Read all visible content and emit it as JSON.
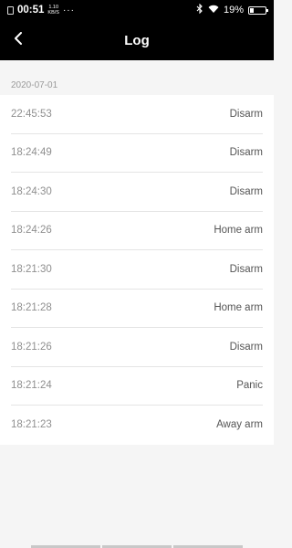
{
  "status_bar": {
    "time": "00:51",
    "speed_value": "1.10",
    "speed_unit": "KB/S",
    "dots": "···",
    "battery": "19%"
  },
  "header": {
    "title": "Log"
  },
  "log": {
    "date": "2020-07-01",
    "entries": [
      {
        "time": "22:45:53",
        "event": "Disarm"
      },
      {
        "time": "18:24:49",
        "event": "Disarm"
      },
      {
        "time": "18:24:30",
        "event": "Disarm"
      },
      {
        "time": "18:24:26",
        "event": "Home arm"
      },
      {
        "time": "18:21:30",
        "event": "Disarm"
      },
      {
        "time": "18:21:28",
        "event": "Home arm"
      },
      {
        "time": "18:21:26",
        "event": "Disarm"
      },
      {
        "time": "18:21:24",
        "event": "Panic"
      },
      {
        "time": "18:21:23",
        "event": "Away arm"
      }
    ]
  }
}
